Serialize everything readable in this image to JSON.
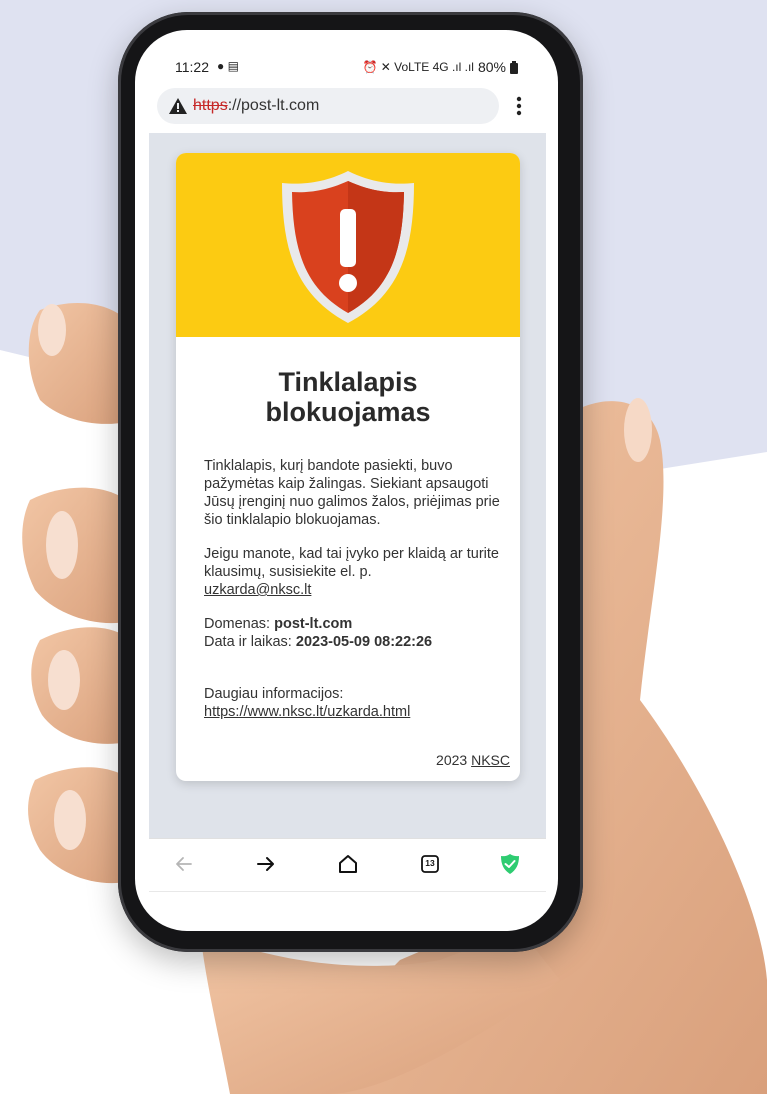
{
  "status_bar": {
    "time": "11:22",
    "left_icons": "● ▤",
    "right_icons": "⏰ ✕ VoLTE 4G .ıl .ıl",
    "battery": "80%"
  },
  "browser": {
    "url_scheme": "https",
    "url_rest": "://post-lt.com",
    "security_icon": "warning-triangle-icon",
    "menu_icon": "kebab-menu-icon"
  },
  "page": {
    "title_line1": "Tinklalapis",
    "title_line2": "blokuojamas",
    "paragraph1": "Tinklalapis, kurį bandote pasiekti, buvo pažymėtas kaip žalingas. Siekiant apsaugoti Jūsų įrenginį nuo galimos žalos, priėjimas prie šio tinklalapio blokuojamas.",
    "paragraph2_prefix": "Jeigu manote, kad tai įvyko per klaidą ar turite klausimų, susisiekite el. p.",
    "contact_email": "uzkarda@nksc.lt",
    "domain_label": "Domenas: ",
    "domain_value": "post-lt.com",
    "datetime_label": "Data ir laikas: ",
    "datetime_value": "2023-05-09 08:22:26",
    "more_info_label": "Daugiau informacijos:",
    "more_info_link": "https://www.nksc.lt/uzkarda.html",
    "footer_year": "2023",
    "footer_link": "NKSC"
  },
  "nav": {
    "tab_count": "13",
    "items": [
      "back-arrow-icon",
      "forward-arrow-icon",
      "home-icon",
      "tabs-icon",
      "shield-check-icon"
    ]
  },
  "colors": {
    "banner": "#fccb12",
    "shield": "#d9411e",
    "insecure_scheme": "#c62828",
    "nav_shield": "#2ecc71",
    "background_shape": "#dfe2f1"
  }
}
